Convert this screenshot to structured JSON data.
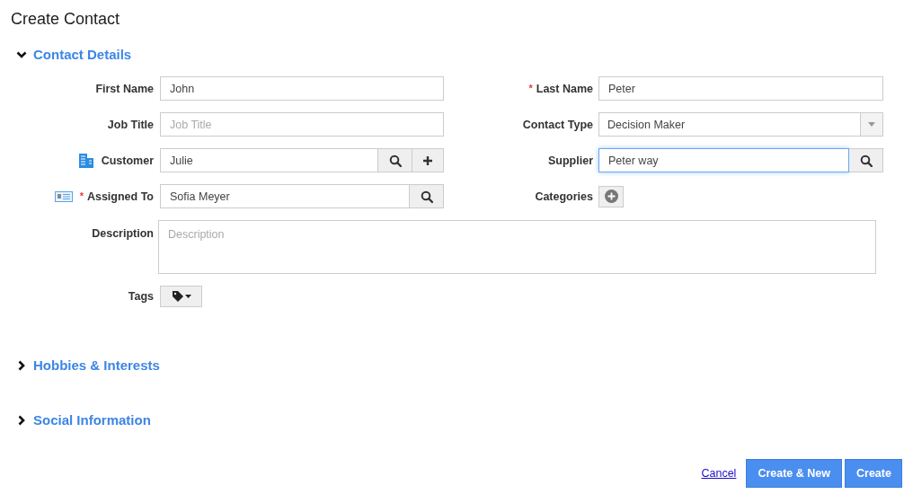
{
  "page": {
    "title": "Create Contact"
  },
  "required_mark": "*",
  "sections": [
    {
      "title": "Contact Details",
      "expanded": true,
      "fields": [
        {
          "kind": "text",
          "label": "First Name",
          "required": false,
          "value": "John"
        },
        {
          "kind": "text",
          "label": "Last Name",
          "required": true,
          "value": "Peter"
        },
        {
          "kind": "text",
          "label": "Job Title",
          "required": false,
          "placeholder": "Job Title"
        },
        {
          "kind": "select",
          "label": "Contact Type",
          "required": false,
          "value": "Decision Maker"
        },
        {
          "kind": "lookup",
          "label": "Customer",
          "required": false,
          "value": "Julie",
          "add_button": true
        },
        {
          "kind": "lookup",
          "label": "Supplier",
          "required": false,
          "value": "Peter way",
          "focused": true,
          "add_button": false
        },
        {
          "kind": "lookup",
          "label": "Assigned To",
          "required": true,
          "value": "Sofia Meyer",
          "add_button": false
        },
        {
          "kind": "categories",
          "label": "Categories",
          "required": false
        },
        {
          "kind": "textarea",
          "label": "Description",
          "required": false,
          "placeholder": "Description"
        },
        {
          "kind": "tags",
          "label": "Tags",
          "required": false
        }
      ]
    },
    {
      "title": "Hobbies & Interests",
      "expanded": false
    },
    {
      "title": "Social Information",
      "expanded": false
    }
  ],
  "footer": {
    "cancel": "Cancel",
    "buttons": [
      "Create & New",
      "Create"
    ]
  }
}
